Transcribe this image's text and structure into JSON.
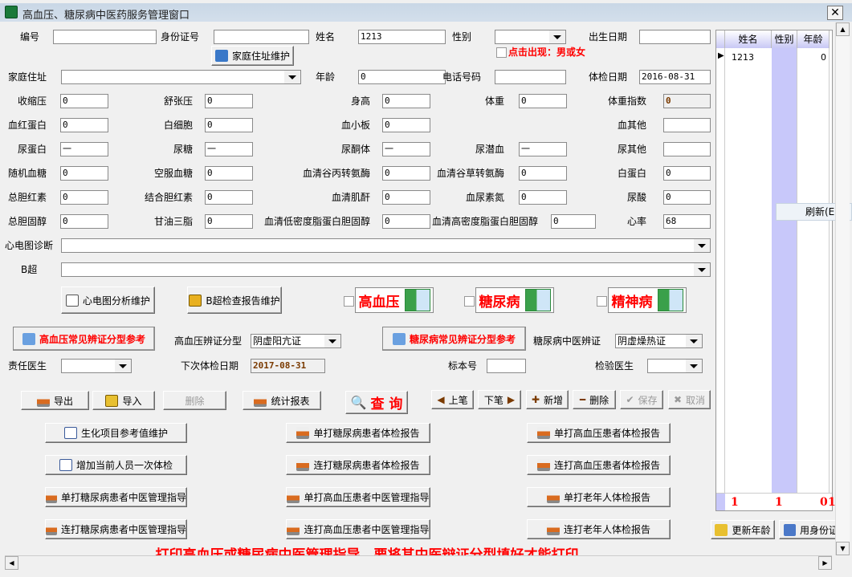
{
  "window": {
    "title": "高血压、糖尿病中医药服务管理窗口",
    "close": "✕"
  },
  "basic": {
    "id_label": "编号",
    "id_value": "",
    "idcard_label": "身份证号",
    "idcard_value": "",
    "name_label": "姓名",
    "name_value": "1213",
    "gender_label": "性别",
    "gender_value": "",
    "birth_label": "出生日期",
    "birth_value": "",
    "address_btn": "家庭住址维护",
    "gender_hint": "点击出现：男或女",
    "address_label": "家庭住址",
    "address_value": "",
    "age_label": "年龄",
    "age_value": "0",
    "phone_label": "电话号码",
    "phone_value": "",
    "exam_date_label": "体检日期",
    "exam_date_value": "2016-08-31"
  },
  "lab": {
    "rows": [
      [
        [
          "收缩压",
          "0"
        ],
        [
          "舒张压",
          "0"
        ],
        [
          "身高",
          "0"
        ],
        [
          "体重",
          "0"
        ],
        [
          "体重指数",
          "0"
        ]
      ],
      [
        [
          "血红蛋白",
          "0"
        ],
        [
          "白细胞",
          "0"
        ],
        [
          "血小板",
          "0"
        ],
        null,
        [
          "血其他",
          ""
        ]
      ],
      [
        [
          "尿蛋白",
          "一"
        ],
        [
          "尿糖",
          "一"
        ],
        [
          "尿酮体",
          "一"
        ],
        [
          "尿潜血",
          "一"
        ],
        [
          "尿其他",
          ""
        ]
      ],
      [
        [
          "随机血糖",
          "0"
        ],
        [
          "空服血糖",
          "0"
        ],
        [
          "血清谷丙转氨酶",
          "0"
        ],
        [
          "血清谷草转氨酶",
          "0"
        ],
        [
          "白蛋白",
          "0"
        ]
      ],
      [
        [
          "总胆红素",
          "0"
        ],
        [
          "结合胆红素",
          "0"
        ],
        [
          "血清肌酐",
          "0"
        ],
        [
          "血尿素氮",
          "0"
        ],
        [
          "尿酸",
          "0"
        ]
      ],
      [
        [
          "总胆固醇",
          "0"
        ],
        [
          "甘油三脂",
          "0"
        ],
        [
          "血清低密度脂蛋白胆固醇",
          "0"
        ],
        [
          "血清高密度脂蛋白胆固醇",
          "0"
        ],
        [
          "心率",
          "68"
        ]
      ]
    ]
  },
  "ecg": {
    "label": "心电图诊断",
    "value": ""
  },
  "bus": {
    "label": "B超",
    "value": ""
  },
  "maint": {
    "ecg_btn": "心电图分析维护",
    "bus_btn": "B超检查报告维护"
  },
  "diseases": [
    {
      "label": "高血压",
      "checked": false
    },
    {
      "label": "糖尿病",
      "checked": false
    },
    {
      "label": "精神病",
      "checked": false
    }
  ],
  "tcm": {
    "htn_ref_btn": "高血压常见辨证分型参考",
    "htn_type_label": "高血压辨证分型",
    "htn_type_value": "阴虚阳亢证",
    "dm_ref_btn": "糖尿病常见辨证分型参考",
    "dm_type_label": "糖尿病中医辨证",
    "dm_type_value": "阴虚燥热证"
  },
  "staff": {
    "doctor_label": "责任医生",
    "doctor_value": "",
    "next_label": "下次体检日期",
    "next_value": "2017-08-31",
    "sample_label": "标本号",
    "sample_value": "",
    "lab_doctor_label": "检验医生",
    "lab_doctor_value": ""
  },
  "toolbar": {
    "export": "导出",
    "import": "导入",
    "delete_disabled": "删除",
    "report": "统计报表",
    "query": "查 询",
    "prev": "上笔",
    "next": "下笔",
    "add": "新增",
    "delete": "删除",
    "save": "保存",
    "cancel": "取消"
  },
  "actions": [
    [
      "生化项目参考值维护",
      "单打糖尿病患者体检报告",
      "单打高血压患者体检报告"
    ],
    [
      "增加当前人员一次体检",
      "连打糖尿病患者体检报告",
      "连打高血压患者体检报告"
    ],
    [
      "单打糖尿病患者中医管理指导",
      "单打高血压患者中医管理指导",
      "单打老年人体检报告"
    ],
    [
      "连打糖尿病患者中医管理指导",
      "连打高血压患者中医管理指导",
      "连打老年人体检报告"
    ]
  ],
  "notice": "打印高血压或糖尿病中医管理指导，要将其中医辩证分型填好才能打印.",
  "grid": {
    "headers": [
      "姓名",
      "性别",
      "年龄"
    ],
    "rows": [
      [
        "1213",
        "",
        "0"
      ]
    ],
    "footer": [
      "1",
      "1",
      "0",
      "1"
    ]
  },
  "context_menu": {
    "refresh": "刷新(E)"
  },
  "side_buttons": {
    "update_age": "更新年龄",
    "use_idcard": "用身份证"
  }
}
